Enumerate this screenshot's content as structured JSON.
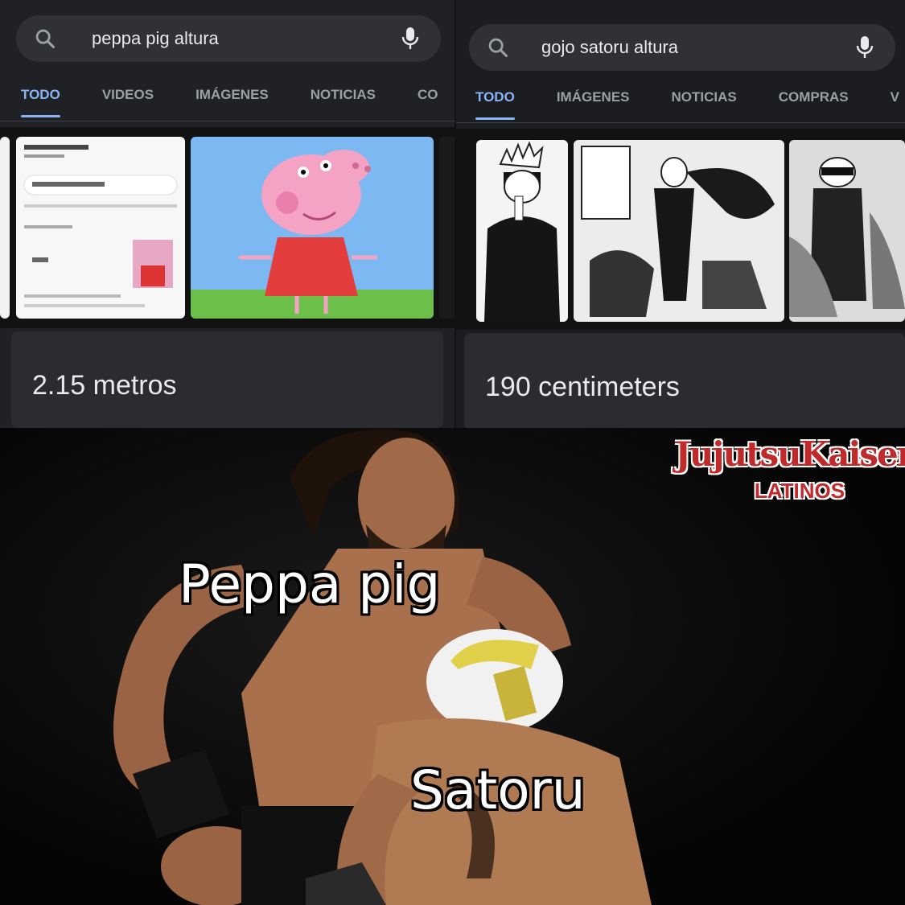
{
  "left_search": {
    "query": "peppa pig altura",
    "tabs": [
      "TODO",
      "VIDEOS",
      "IMÁGENES",
      "NOTICIAS",
      "CO"
    ],
    "active_tab": "TODO",
    "answer": "2.15 metros"
  },
  "right_search": {
    "query": "gojo satoru altura",
    "tabs": [
      "TODO",
      "IMÁGENES",
      "NOTICIAS",
      "COMPRAS",
      "V"
    ],
    "active_tab": "TODO",
    "answer": "190 centimeters"
  },
  "meme": {
    "caption_top": "Peppa pig",
    "caption_bottom": "Satoru",
    "watermark_title": "JujutsuKaisen",
    "watermark_sub": "LATINOS"
  },
  "icons": {
    "search": "search-icon",
    "mic": "mic-icon"
  },
  "colors": {
    "accent": "#8ab4f8",
    "background": "#202124",
    "watermark": "#c12a2a"
  }
}
